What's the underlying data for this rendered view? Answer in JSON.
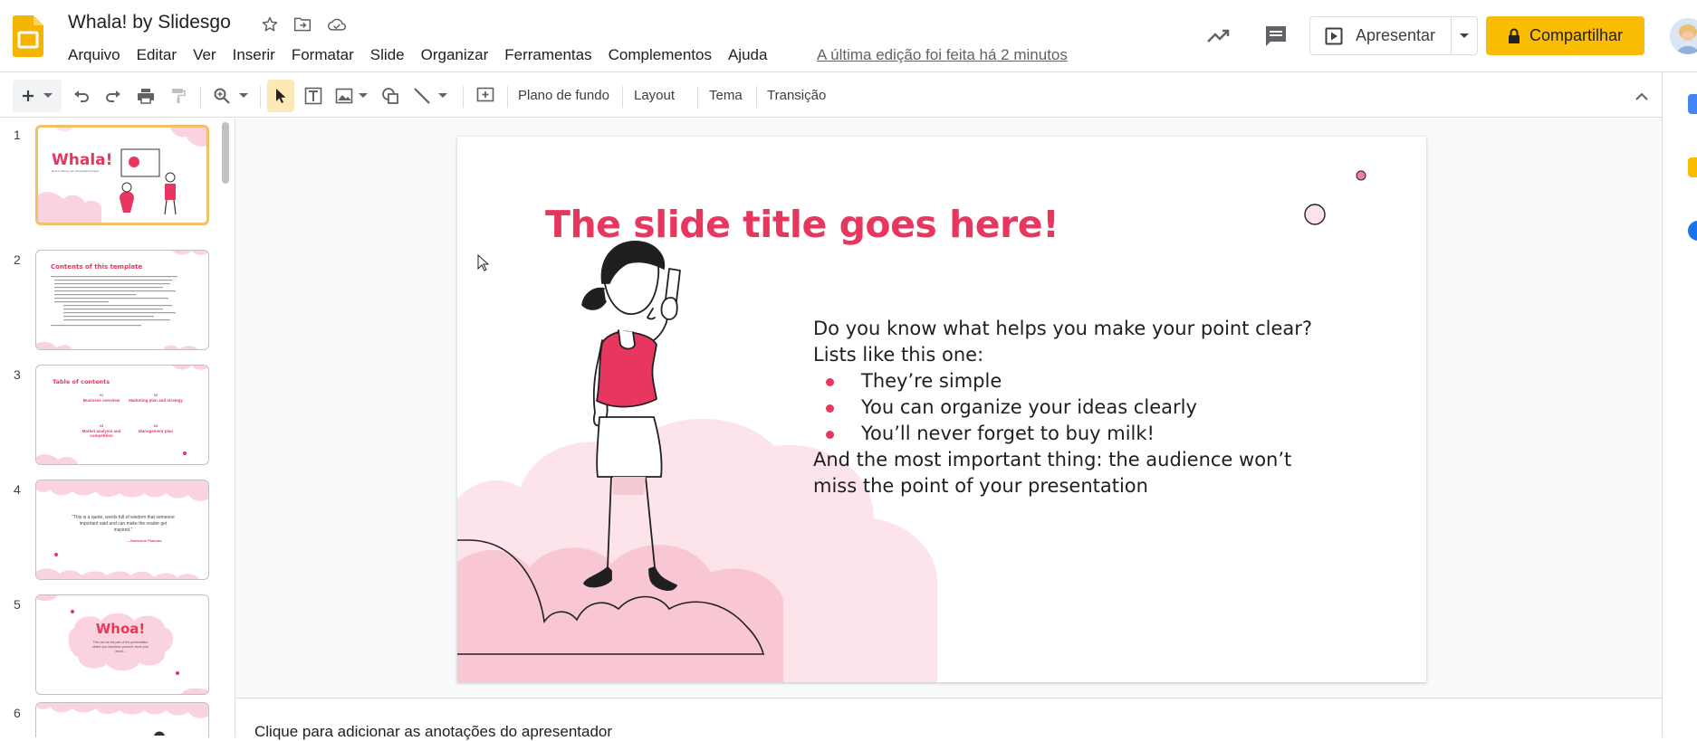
{
  "header": {
    "doc_title": "Whala! by Slidesgo",
    "last_edit": "A última edição foi feita há 2 minutos",
    "present_label": "Apresentar",
    "share_label": "Compartilhar",
    "icons": [
      "star-icon",
      "move-to-folder-icon",
      "cloud-saved-icon",
      "activity-trend-icon",
      "comment-icon",
      "present-icon",
      "lock-icon"
    ]
  },
  "menu": [
    "Arquivo",
    "Editar",
    "Ver",
    "Inserir",
    "Formatar",
    "Slide",
    "Organizar",
    "Ferramentas",
    "Complementos",
    "Ajuda"
  ],
  "toolbar": {
    "background": "Plano de fundo",
    "layout": "Layout",
    "theme": "Tema",
    "transition": "Transição"
  },
  "filmstrip": {
    "slides": [
      {
        "num": "1",
        "title": "Whala!",
        "subtitle": "Here is where your presentation begins"
      },
      {
        "num": "2",
        "title": "Contents of this template"
      },
      {
        "num": "3",
        "title": "Table of contents",
        "items": [
          "01",
          "Business overview",
          "02",
          "Marketing plan and strategy",
          "03",
          "Market analysis and competition",
          "04",
          "Management plan"
        ]
      },
      {
        "num": "4",
        "quote": "“This is a quote, words full of wisdom that someone important said and can make the reader get inspired.”",
        "author": "—Someone Famous"
      },
      {
        "num": "5",
        "title": "Whoa!",
        "subtitle": "This can be the part of the presentation where you introduce yourself, send your email..."
      },
      {
        "num": "6"
      }
    ]
  },
  "slide": {
    "title": "The slide title goes here!",
    "intro_1": "Do you know what helps you make your point clear?",
    "intro_2": "Lists like this one:",
    "bullets": [
      "They’re simple",
      "You can organize your ideas clearly",
      "You’ll never forget to buy milk!"
    ],
    "outro_1": "And the most important thing: the audience won’t",
    "outro_2": "miss the point of your presentation"
  },
  "notes": {
    "placeholder": "Clique para adicionar as anotações do apresentador"
  },
  "colors": {
    "accent": "#e8375f",
    "share": "#fbbc04",
    "slides_logo": "#f4b400",
    "cloud_light": "#fde4ea",
    "cloud_mid": "#f9c6d3"
  }
}
